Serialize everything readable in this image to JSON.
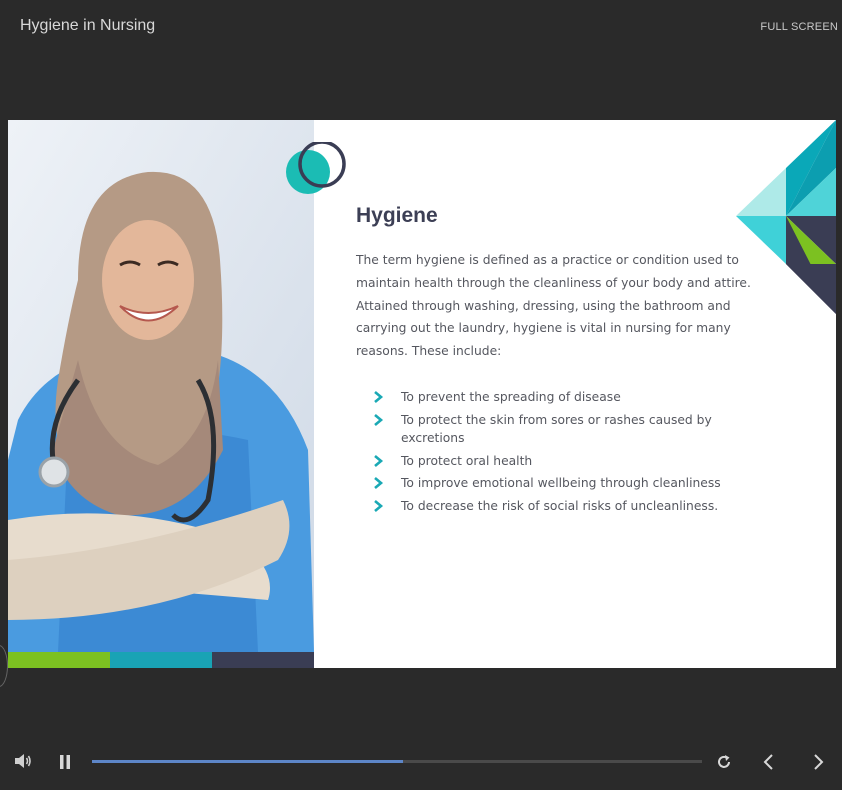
{
  "header": {
    "title": "Hygiene in Nursing",
    "fullscreen_label": "FULL SCREEN"
  },
  "slide": {
    "heading": "Hygiene",
    "paragraph": "The term hygiene is defined as a practice or condition used to maintain health through the cleanliness of your body and attire. Attained through washing, dressing, using the bathroom and carrying out the laundry, hygiene is vital in nursing for many reasons. These include:",
    "bullets": [
      "To prevent the spreading of disease",
      "To protect the skin from sores or rashes caused by excretions",
      "To protect oral health",
      "To improve emotional wellbeing through cleanliness",
      "To decrease the risk of social risks of uncleanliness."
    ],
    "image_icon": "nurse-photo"
  },
  "player": {
    "progress": 0.51,
    "icons": {
      "volume": "volume-icon",
      "pause": "pause-icon",
      "replay": "replay-icon",
      "prev": "chevron-left-icon",
      "next": "chevron-right-icon"
    }
  },
  "colors": {
    "background": "#2a2a2a",
    "teal": "#1ab5b4",
    "blue": "#2b9fc0",
    "green": "#7cc121",
    "navy": "#3a3d54",
    "progress": "#5d86c8"
  }
}
